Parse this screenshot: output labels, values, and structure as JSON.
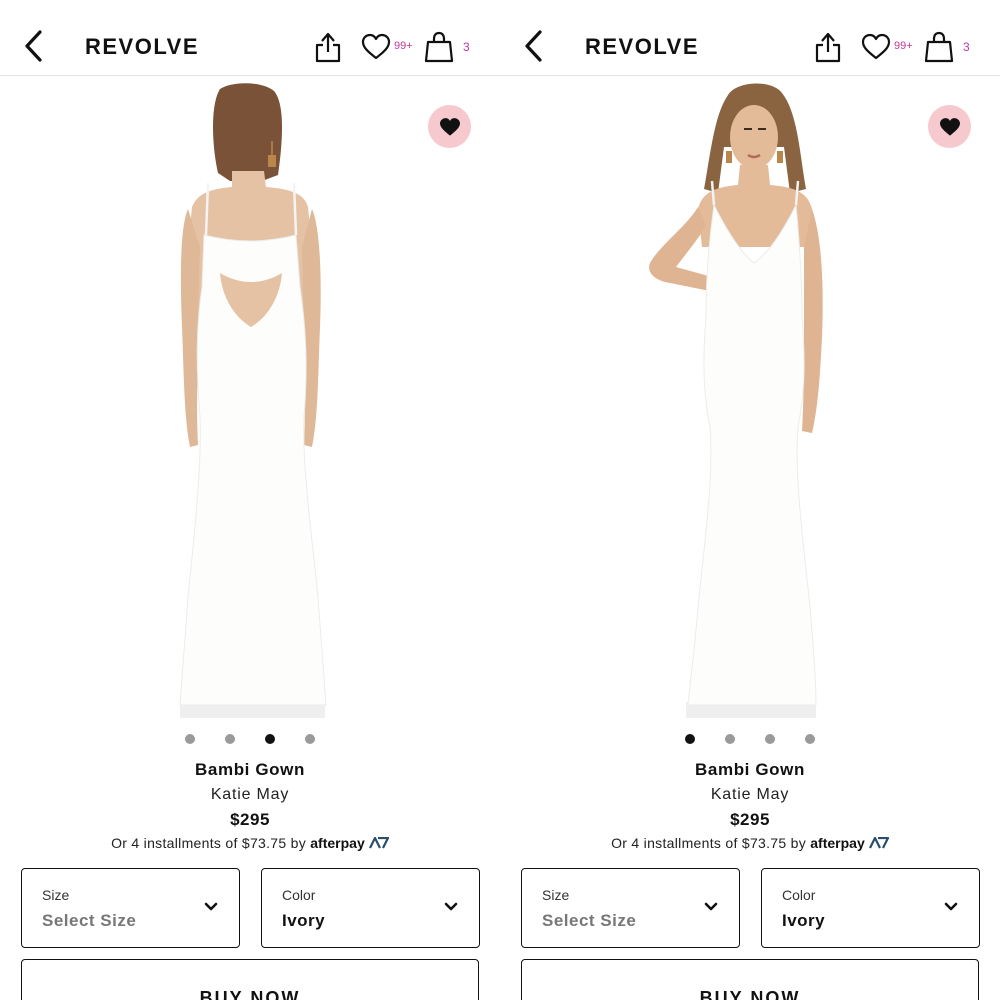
{
  "panels": [
    {
      "header": {
        "logo": "REVOLVE",
        "wishlist_count": "99+",
        "bag_count": "3"
      },
      "image_view": "back",
      "carousel": {
        "count": 4,
        "active": 2
      },
      "product": {
        "name": "Bambi Gown",
        "brand": "Katie May",
        "price": "$295",
        "installments": "Or 4 installments of $73.75 by",
        "afterpay": "afterpay"
      },
      "size": {
        "label": "Size",
        "value": "Select Size"
      },
      "color": {
        "label": "Color",
        "value": "Ivory"
      },
      "buy_label": "BUY NOW"
    },
    {
      "header": {
        "logo": "REVOLVE",
        "wishlist_count": "99+",
        "bag_count": "3"
      },
      "image_view": "front",
      "carousel": {
        "count": 4,
        "active": 0
      },
      "product": {
        "name": "Bambi Gown",
        "brand": "Katie May",
        "price": "$295",
        "installments": "Or 4 installments of $73.75 by",
        "afterpay": "afterpay"
      },
      "size": {
        "label": "Size",
        "value": "Select Size"
      },
      "color": {
        "label": "Color",
        "value": "Ivory"
      },
      "buy_label": "BUY NOW"
    }
  ],
  "icons": {
    "back": "chevron-left-icon",
    "share": "share-icon",
    "wishlist": "heart-outline-icon",
    "bag": "shopping-bag-icon",
    "favorite": "heart-filled-icon",
    "dropdown": "chevron-down-icon"
  },
  "colors": {
    "accent": "#c0399b",
    "favorite_bg": "#f6c9cf",
    "dot_active": "#111111",
    "dot_inactive": "#9a9a9a"
  }
}
